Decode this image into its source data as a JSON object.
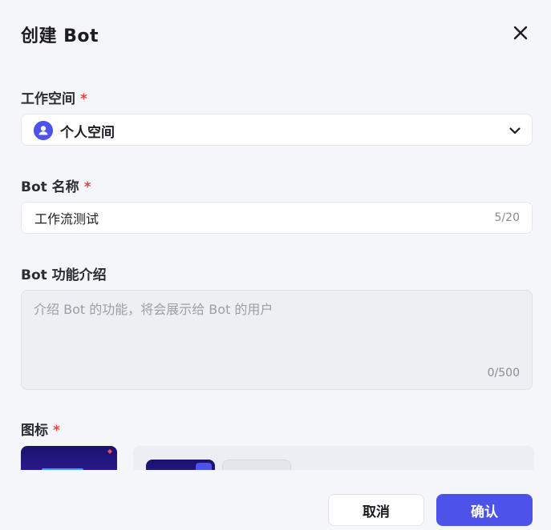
{
  "dialog": {
    "title": "创建 Bot"
  },
  "workspace": {
    "label": "工作空间",
    "required_mark": "*",
    "selected": "个人空间",
    "icon": "user-avatar-icon"
  },
  "bot_name": {
    "label": "Bot 名称",
    "required_mark": "*",
    "value": "工作流测试",
    "counter": "5/20"
  },
  "description": {
    "label": "Bot 功能介绍",
    "placeholder": "介绍 Bot 的功能，将会展示给 Bot 的用户",
    "value": "",
    "counter": "0/500"
  },
  "icon_section": {
    "label": "图标",
    "required_mark": "*"
  },
  "footer": {
    "cancel_label": "取消",
    "confirm_label": "确认"
  },
  "colors": {
    "accent": "#4d53e8",
    "required": "#f53f3f",
    "background": "#f5f6fa"
  }
}
